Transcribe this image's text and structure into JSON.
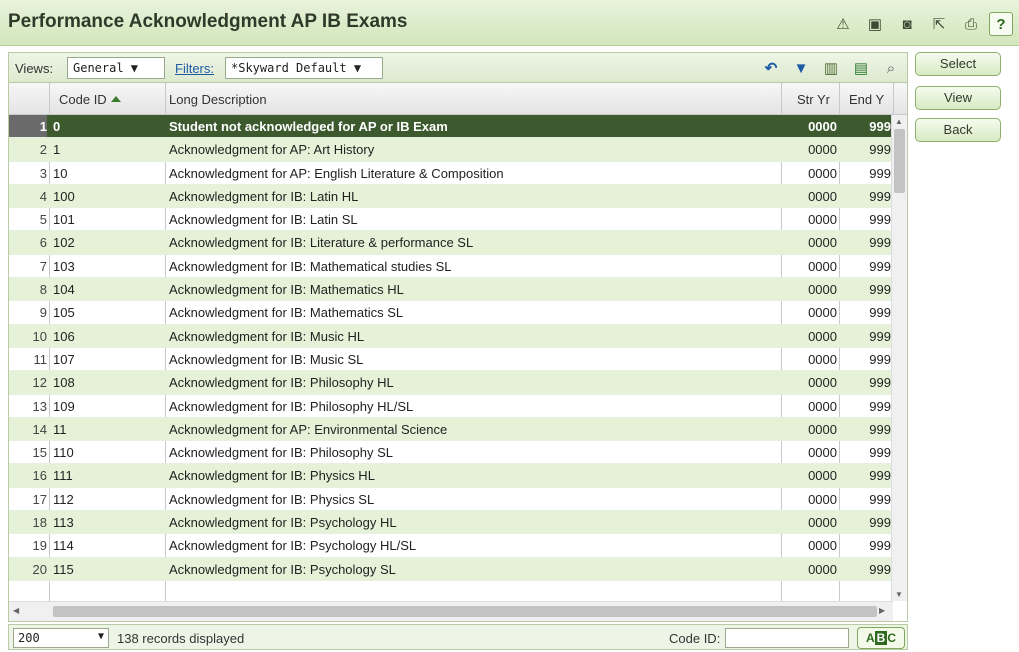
{
  "window": {
    "title": "Performance Acknowledgment AP IB Exams",
    "title_icons": [
      "warning-person-icon",
      "monitor-icon",
      "camera-icon",
      "export-icon",
      "print-icon",
      "help-icon"
    ],
    "help_label": "?"
  },
  "toolbar": {
    "views_label": "Views:",
    "views_value": "General ▼",
    "filters_label": "Filters:",
    "filters_value": "*Skyward Default ▼",
    "icons": [
      "undo-icon",
      "filter-icon",
      "chart-icon",
      "excel-icon",
      "print-preview-icon"
    ]
  },
  "grid": {
    "columns": {
      "code": "Code ID",
      "desc": "Long Description",
      "start_year": "Str Yr",
      "end_year": "End Y"
    },
    "rows": [
      {
        "n": "1",
        "code": "0",
        "desc": "Student not acknowledged for AP or IB Exam",
        "sy": "0000",
        "ey": "999"
      },
      {
        "n": "2",
        "code": "1",
        "desc": "Acknowledgment for AP: Art History",
        "sy": "0000",
        "ey": "999"
      },
      {
        "n": "3",
        "code": "10",
        "desc": "Acknowledgment for AP: English Literature & Composition",
        "sy": "0000",
        "ey": "999"
      },
      {
        "n": "4",
        "code": "100",
        "desc": "Acknowledgment for IB: Latin HL",
        "sy": "0000",
        "ey": "999"
      },
      {
        "n": "5",
        "code": "101",
        "desc": "Acknowledgment for IB: Latin SL",
        "sy": "0000",
        "ey": "999"
      },
      {
        "n": "6",
        "code": "102",
        "desc": "Acknowledgment for IB: Literature & performance SL",
        "sy": "0000",
        "ey": "999"
      },
      {
        "n": "7",
        "code": "103",
        "desc": "Acknowledgment for IB: Mathematical studies SL",
        "sy": "0000",
        "ey": "999"
      },
      {
        "n": "8",
        "code": "104",
        "desc": "Acknowledgment for IB: Mathematics HL",
        "sy": "0000",
        "ey": "999"
      },
      {
        "n": "9",
        "code": "105",
        "desc": "Acknowledgment for IB: Mathematics SL",
        "sy": "0000",
        "ey": "999"
      },
      {
        "n": "10",
        "code": "106",
        "desc": "Acknowledgment for IB: Music HL",
        "sy": "0000",
        "ey": "999"
      },
      {
        "n": "11",
        "code": "107",
        "desc": "Acknowledgment for IB: Music SL",
        "sy": "0000",
        "ey": "999"
      },
      {
        "n": "12",
        "code": "108",
        "desc": "Acknowledgment for IB: Philosophy HL",
        "sy": "0000",
        "ey": "999"
      },
      {
        "n": "13",
        "code": "109",
        "desc": "Acknowledgment for IB: Philosophy HL/SL",
        "sy": "0000",
        "ey": "999"
      },
      {
        "n": "14",
        "code": "11",
        "desc": "Acknowledgment for AP: Environmental Science",
        "sy": "0000",
        "ey": "999"
      },
      {
        "n": "15",
        "code": "110",
        "desc": "Acknowledgment for IB: Philosophy SL",
        "sy": "0000",
        "ey": "999"
      },
      {
        "n": "16",
        "code": "111",
        "desc": "Acknowledgment for IB: Physics HL",
        "sy": "0000",
        "ey": "999"
      },
      {
        "n": "17",
        "code": "112",
        "desc": "Acknowledgment for IB: Physics SL",
        "sy": "0000",
        "ey": "999"
      },
      {
        "n": "18",
        "code": "113",
        "desc": "Acknowledgment for IB: Psychology HL",
        "sy": "0000",
        "ey": "999"
      },
      {
        "n": "19",
        "code": "114",
        "desc": "Acknowledgment for IB: Psychology HL/SL",
        "sy": "0000",
        "ey": "999"
      },
      {
        "n": "20",
        "code": "115",
        "desc": "Acknowledgment for IB: Psychology SL",
        "sy": "0000",
        "ey": "999"
      }
    ],
    "selected_row": 1
  },
  "side_buttons": {
    "select": "Select",
    "view": "View",
    "back": "Back"
  },
  "footer": {
    "per_page": "200",
    "records_text": "138 records displayed",
    "code_id_label": "Code ID:",
    "code_id_value": "",
    "abc_a": "A",
    "abc_b": "B",
    "abc_c": "C"
  },
  "colors": {
    "header_bg": "#d2e6bb",
    "row_alt": "#e6f2d8",
    "row_selected": "#3d5a2f",
    "accent": "#2d6a1e"
  }
}
